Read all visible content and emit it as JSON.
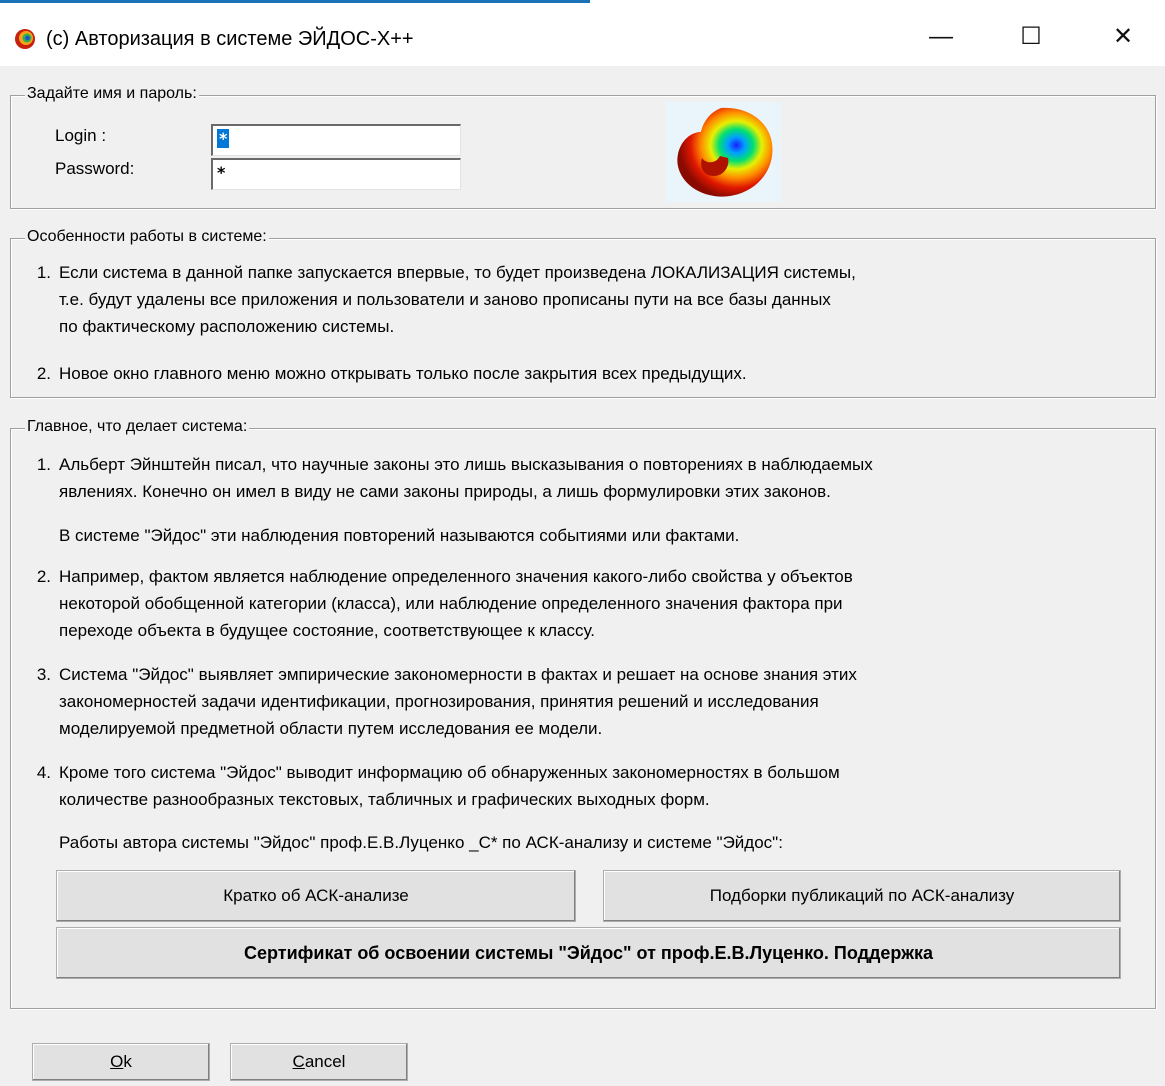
{
  "window": {
    "title": "(c) Авторизация в системе ЭЙДОС-X++",
    "minimize_glyph": "—",
    "maximize_glyph": "☐",
    "close_glyph": "✕"
  },
  "credentials": {
    "legend": "Задайте имя и пароль:",
    "login_label": "Login  :",
    "login_value": "*",
    "password_label": "Password:",
    "password_value": "*"
  },
  "features": {
    "legend": "Особенности работы в системе:",
    "items": [
      {
        "num": "1.",
        "lines": [
          "Если система в данной папке запускается впервые, то будет произведена ЛОКАЛИЗАЦИЯ системы,",
          "т.е. будут удалены все приложения и пользователи и заново прописаны пути на все базы данных",
          "по фактическому расположению системы."
        ]
      },
      {
        "num": "2.",
        "lines": [
          "Новое окно главного меню можно открывать только после закрытия всех предыдущих."
        ]
      }
    ]
  },
  "main": {
    "legend": "Главное, что делает система:",
    "item1": {
      "num": "1.",
      "lines": [
        "Альберт Эйнштейн писал, что научные законы это лишь высказывания о повторениях в наблюдаемых",
        "явлениях. Конечно он имел в виду не сами законы природы, а лишь формулировки этих законов."
      ],
      "note": "В системе \"Эйдос\" эти наблюдения повторений называются событиями или фактами."
    },
    "item2": {
      "num": "2.",
      "lines": [
        "Например, фактом является наблюдение определенного значения какого-либо свойства у объектов",
        "некоторой обобщенной категории (класса), или наблюдение определенного значения фактора при",
        "переходе объекта в будущее состояние, соответствующее к классу."
      ]
    },
    "item3": {
      "num": "3.",
      "lines": [
        "Система \"Эйдос\" выявляет эмпирические закономерности в фактах и решает на основе знания этих",
        "закономерностей задачи идентификации, прогнозирования, принятия решений и исследования",
        "моделируемой предметной области путем исследования ее модели."
      ]
    },
    "item4": {
      "num": "4.",
      "lines": [
        "Кроме того система \"Эйдос\" выводит информацию об обнаруженных закономерностях в большом",
        "количестве разнообразных текстовых, табличных и графических выходных форм."
      ],
      "note": "Работы автора системы \"Эйдос\" проф.Е.В.Луценко _С* по АСК-анализу и системе \"Эйдос\":"
    },
    "btn_brief": "Кратко об АСК-анализе",
    "btn_publications": "Подборки публикаций по АСК-анализу",
    "btn_certificate": "Сертификат об освоении системы \"Эйдос\" от проф.Е.В.Луценко. Поддержка"
  },
  "footer": {
    "ok_accel": "O",
    "ok_rest": "k",
    "cancel_accel": "C",
    "cancel_rest": "ancel"
  },
  "icons": {
    "app": "eidos-spiral-icon",
    "logo": "eidos-spiral-logo"
  }
}
